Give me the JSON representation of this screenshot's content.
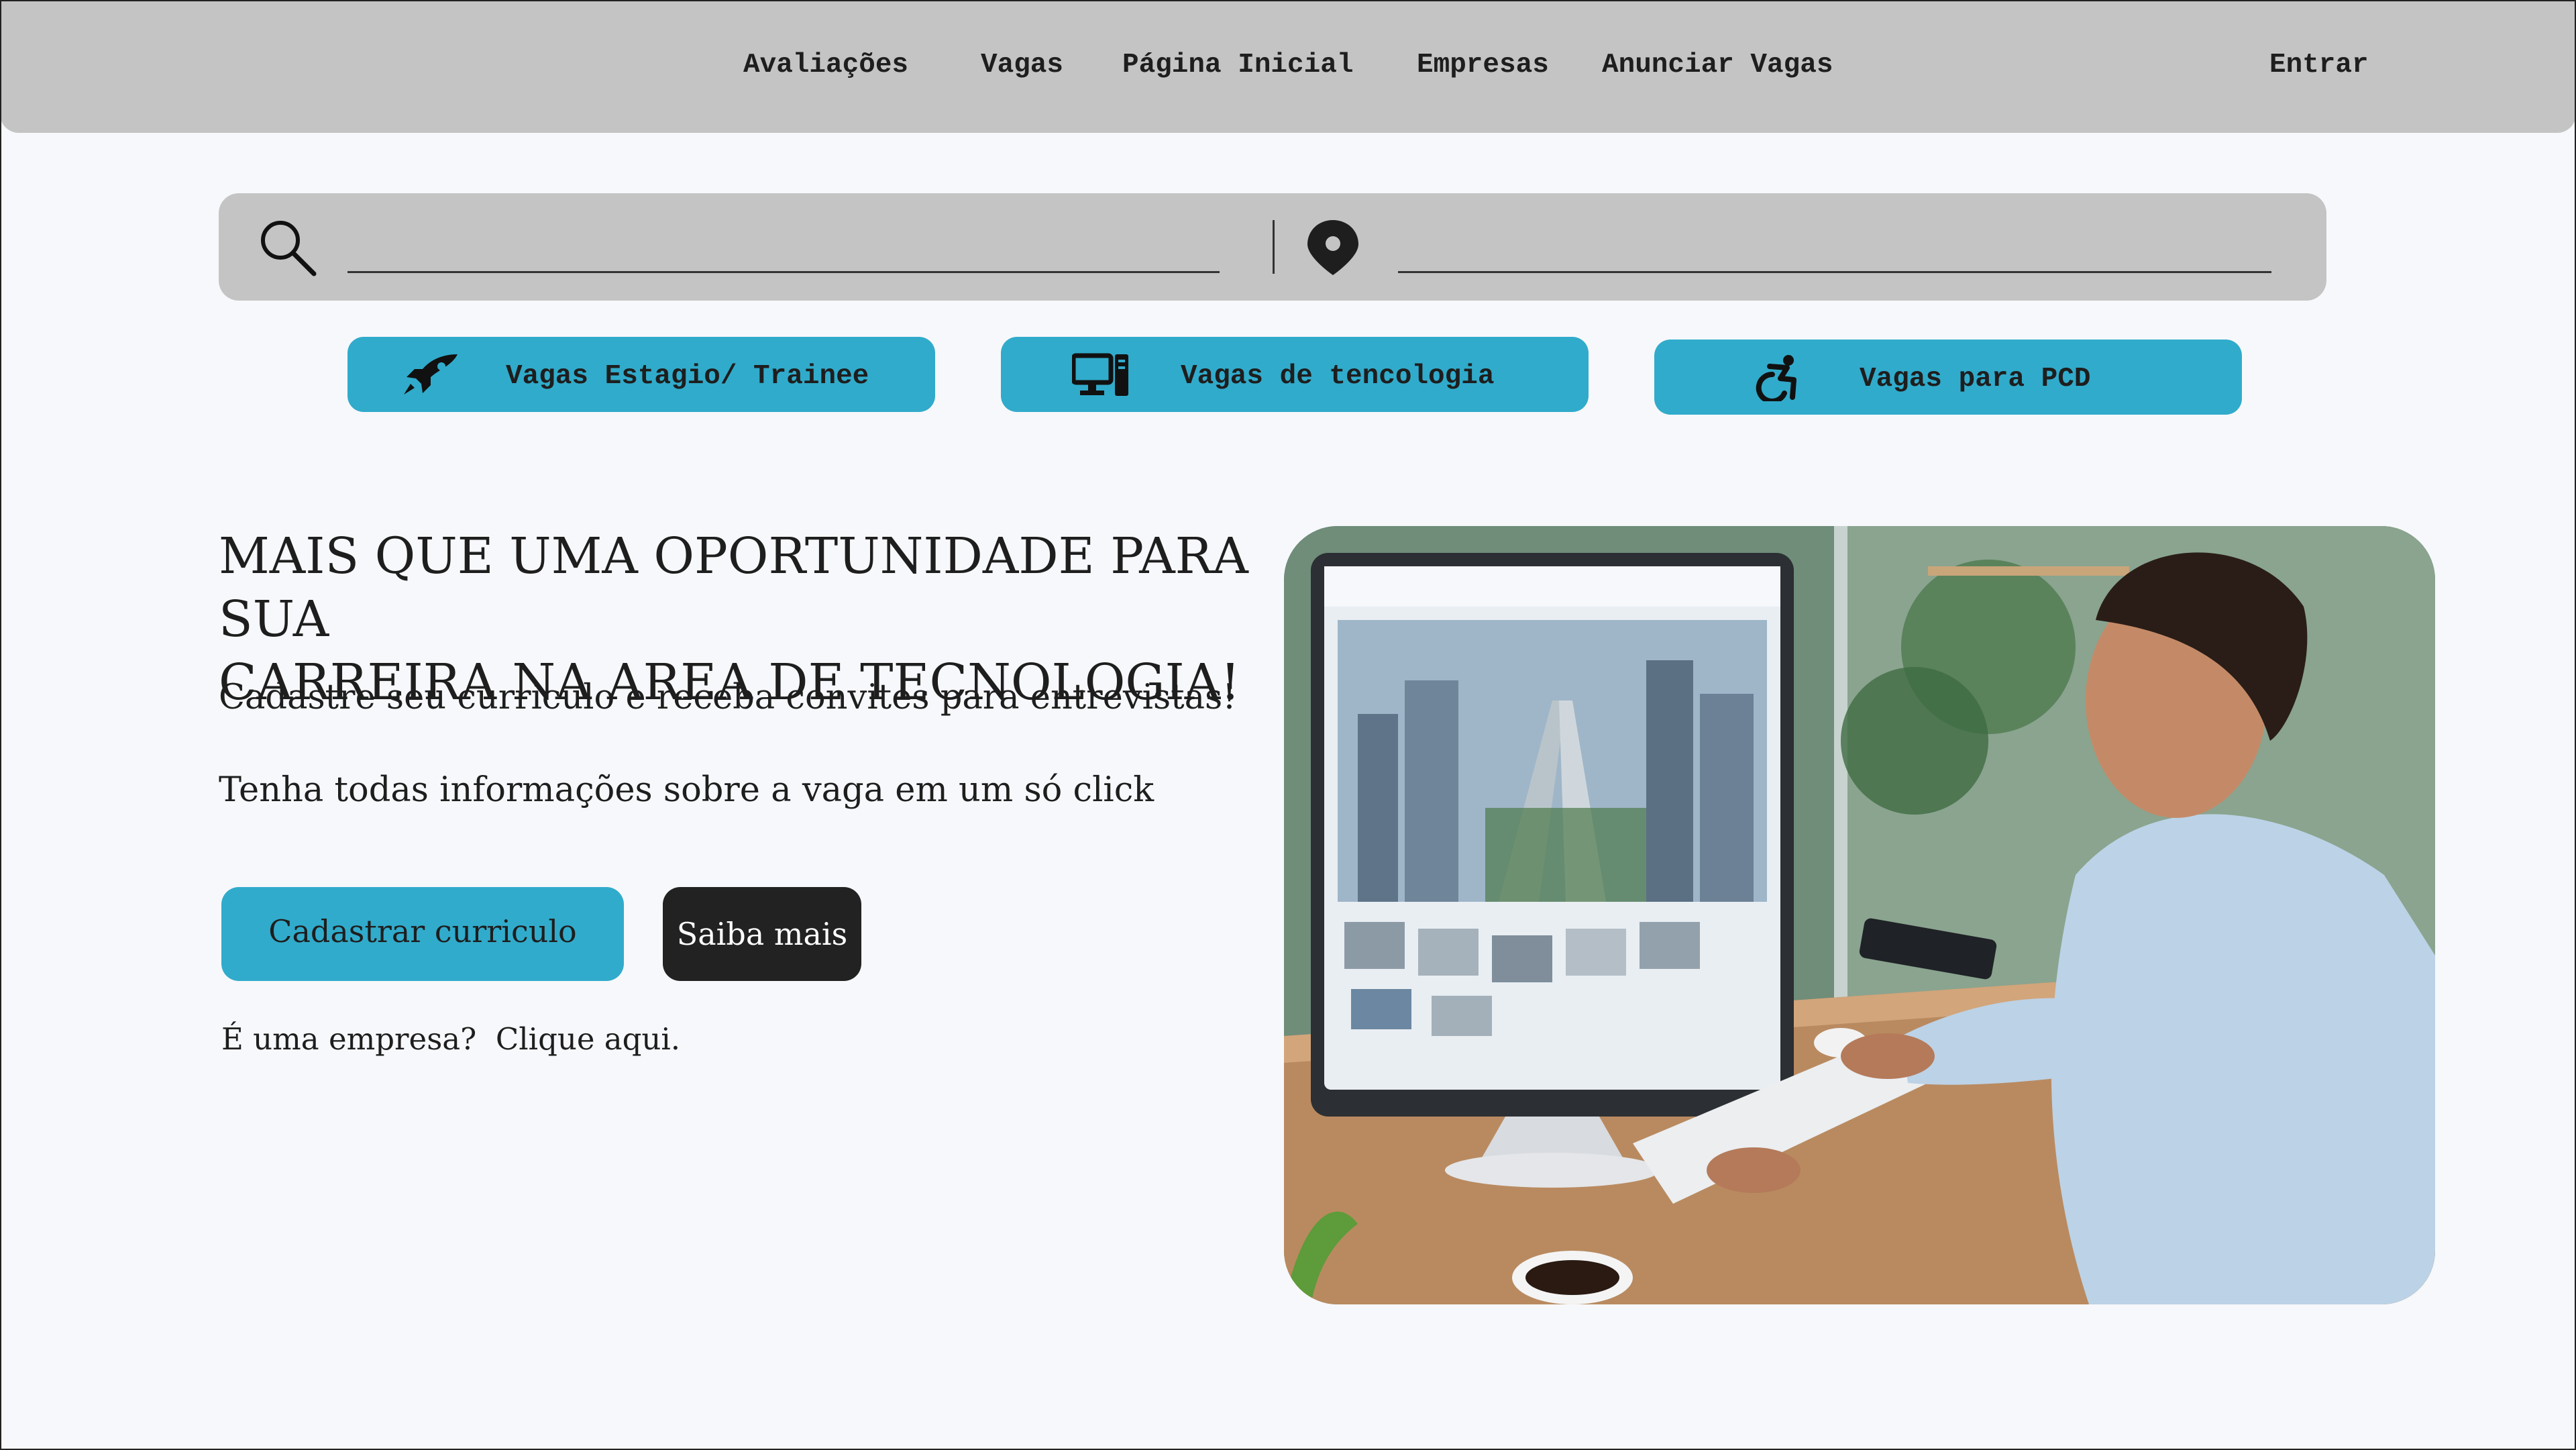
{
  "nav": {
    "links": [
      "Avaliações",
      "Vagas",
      "Página Inicial",
      "Empresas",
      "Anunciar Vagas"
    ],
    "login": "Entrar"
  },
  "search": {
    "keyword_value": "",
    "location_value": ""
  },
  "categories": [
    {
      "label": "Vagas Estagio/ Trainee",
      "icon": "rocket-icon"
    },
    {
      "label": "Vagas de tencologia",
      "icon": "computer-icon"
    },
    {
      "label": "Vagas para PCD",
      "icon": "wheelchair-icon"
    }
  ],
  "hero": {
    "title_line1": "MAIS QUE UMA OPORTUNIDADE PARA SUA",
    "title_line2": "CARREIRA NA AREA DE TECNOLOGIA!",
    "text1": "Cadastre seu curriculo e receba convites para entrevistas!",
    "text2": "Tenha todas informações sobre a vaga em um só click",
    "primary_button": "Cadastrar curriculo",
    "secondary_button": "Saiba mais",
    "company_question": "É uma empresa?",
    "company_link": "Clique aqui."
  },
  "colors": {
    "accent": "#31abcb",
    "bar": "#c4c4c4",
    "dark": "#222222",
    "background": "#f7f8fb"
  }
}
